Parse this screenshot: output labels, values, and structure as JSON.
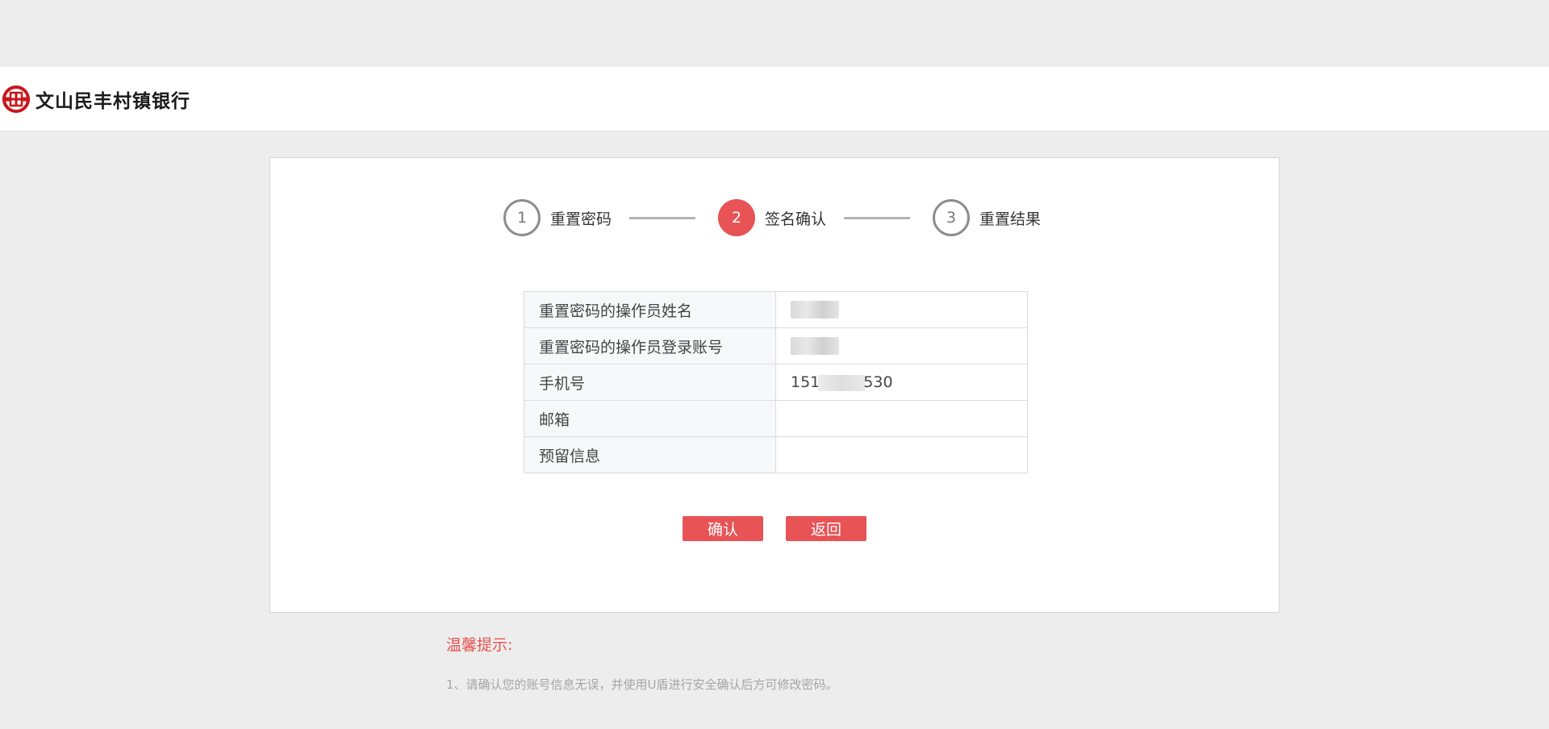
{
  "header": {
    "bank_name": "文山民丰村镇银行",
    "logo_icon": "bank-logo-icon",
    "brand_color": "#c8161d"
  },
  "steps": [
    {
      "number": "1",
      "label": "重置密码",
      "state": "done"
    },
    {
      "number": "2",
      "label": "签名确认",
      "state": "active"
    },
    {
      "number": "3",
      "label": "重置结果",
      "state": "pending"
    }
  ],
  "info_table": {
    "rows": [
      {
        "label": "重置密码的操作员姓名",
        "value": ""
      },
      {
        "label": "重置密码的操作员登录账号",
        "value": ""
      },
      {
        "label": "手机号",
        "value_prefix": "151",
        "value_suffix": "530"
      },
      {
        "label": "邮箱",
        "value": ""
      },
      {
        "label": "预留信息",
        "value": ""
      }
    ]
  },
  "buttons": {
    "confirm": "确认",
    "back": "返回"
  },
  "tips": {
    "title": "温馨提示:",
    "items": [
      "1、请确认您的账号信息无误，并使用U盾进行安全确认后方可修改密码。"
    ]
  },
  "colors": {
    "accent": "#e85356",
    "background": "#ededed"
  }
}
